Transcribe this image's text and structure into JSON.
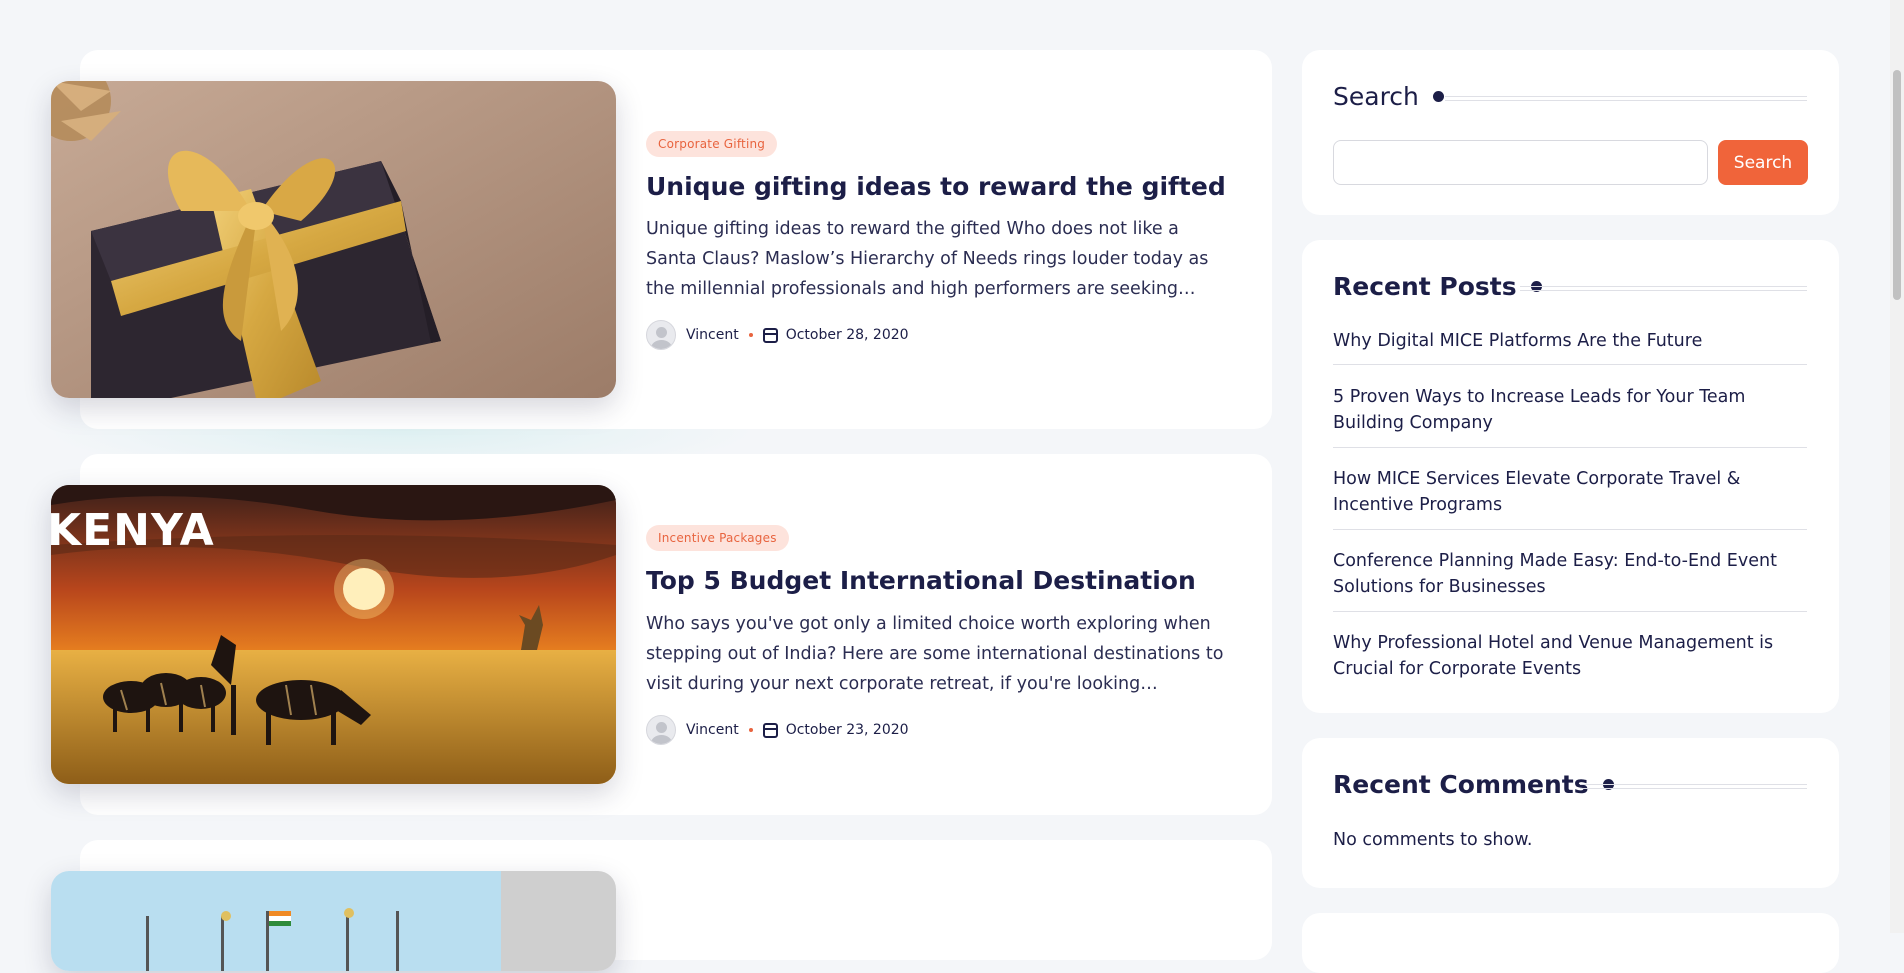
{
  "posts": [
    {
      "category": "Corporate Gifting",
      "title": "Unique gifting ideas to reward the gifted",
      "excerpt": "Unique gifting ideas to reward the gifted Who does not like a Santa Claus?  Maslow’s Hierarchy of Needs rings louder today as the millennial professionals and high performers are seeking…",
      "author": "Vincent",
      "date": "October 28, 2020",
      "image": "gift-box-image"
    },
    {
      "category": "Incentive Packages",
      "title": "Top 5 Budget International Destination",
      "excerpt": "Who says you've got only a limited choice worth exploring when stepping out of India? Here are some international destinations to visit during your next corporate retreat, if you're looking…",
      "author": "Vincent",
      "date": "October 23, 2020",
      "image": "kenya-sunset-image",
      "image_text": "KENYA"
    }
  ],
  "sidebar": {
    "search": {
      "title": "Search",
      "placeholder": "",
      "value": "",
      "button_label": "Search"
    },
    "recent_posts": {
      "title": "Recent Posts",
      "items": [
        "Why Digital MICE Platforms Are the Future",
        "5 Proven Ways to Increase Leads for Your Team Building Company",
        "How MICE Services Elevate Corporate Travel & Incentive Programs",
        "Conference Planning Made Easy: End-to-End Event Solutions for Businesses",
        "Why Professional Hotel and Venue Management is Crucial for Corporate Events"
      ]
    },
    "recent_comments": {
      "title": "Recent Comments",
      "empty_text": "No comments to show."
    }
  },
  "colors": {
    "accent": "#f0643a",
    "badge_bg": "#fde3dc",
    "heading": "#1c1e47",
    "page_bg": "#f4f6f9"
  }
}
